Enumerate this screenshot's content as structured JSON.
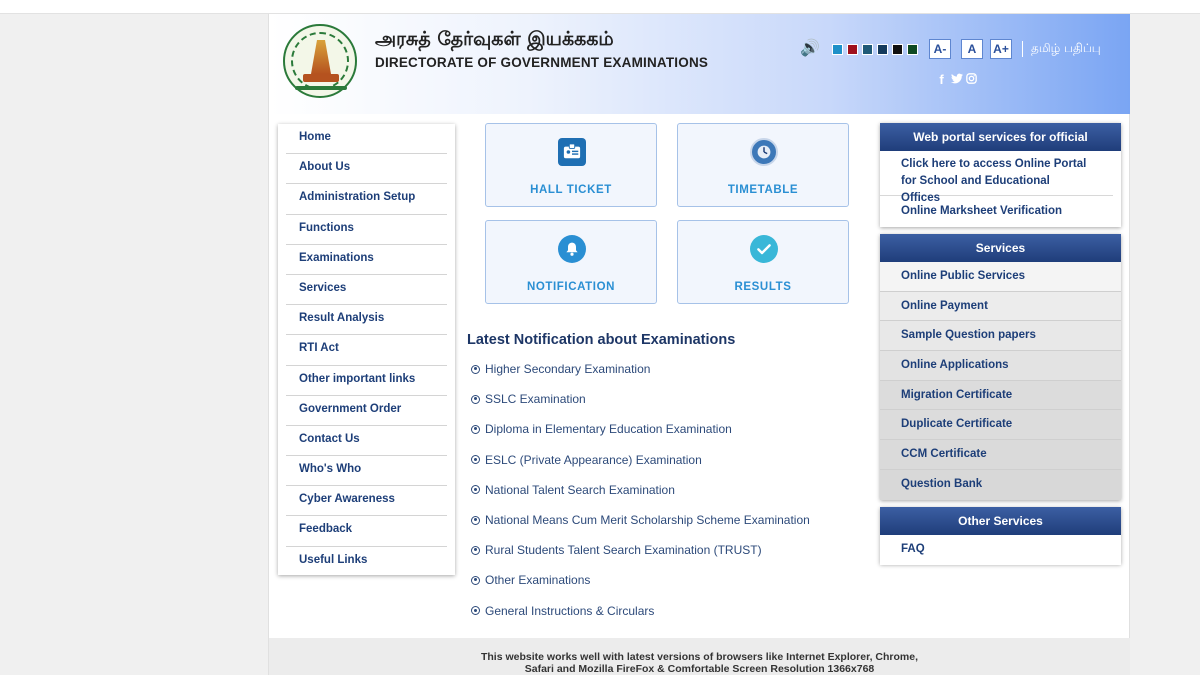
{
  "header": {
    "title_tamil": "அரசுத் தேர்வுகள் இயக்ககம்",
    "title_english": "DIRECTORATE OF GOVERNMENT EXAMINATIONS",
    "font_decrease": "A-",
    "font_normal": "A",
    "font_increase": "A+",
    "tamil_edition": "தமிழ் பதிப்பு",
    "theme_colors": [
      "#1e90c8",
      "#a0101c",
      "#1f5a78",
      "#143a5c",
      "#111111",
      "#0e4a22"
    ],
    "social_icons": [
      "facebook-icon",
      "twitter-icon",
      "instagram-icon"
    ]
  },
  "left_nav": {
    "items": [
      {
        "label": "Home"
      },
      {
        "label": "About Us"
      },
      {
        "label": "Administration Setup"
      },
      {
        "label": "Functions"
      },
      {
        "label": "Examinations"
      },
      {
        "label": "Services"
      },
      {
        "label": "Result Analysis"
      },
      {
        "label": "RTI Act"
      },
      {
        "label": "Other important links"
      },
      {
        "label": "Government Order"
      },
      {
        "label": "Contact Us"
      },
      {
        "label": "Who's Who"
      },
      {
        "label": "Cyber Awareness"
      },
      {
        "label": "Feedback"
      },
      {
        "label": "Useful Links"
      }
    ]
  },
  "tiles": [
    {
      "label": "HALL TICKET",
      "icon": "id-card-icon"
    },
    {
      "label": "TIMETABLE",
      "icon": "clock-icon"
    },
    {
      "label": "NOTIFICATION",
      "icon": "bell-icon"
    },
    {
      "label": "RESULTS",
      "icon": "check-circle-icon"
    }
  ],
  "notifications": {
    "title": "Latest Notification about Examinations",
    "items": [
      {
        "label": "Higher Secondary Examination"
      },
      {
        "label": "SSLC Examination"
      },
      {
        "label": "Diploma in Elementary Education Examination"
      },
      {
        "label": "ESLC (Private Appearance) Examination"
      },
      {
        "label": "National Talent Search Examination"
      },
      {
        "label": "National Means Cum Merit Scholarship Scheme Examination"
      },
      {
        "label": "Rural Students Talent Search Examination (TRUST)"
      },
      {
        "label": "Other Examinations"
      },
      {
        "label": "General Instructions & Circulars"
      }
    ]
  },
  "web_portal": {
    "title": "Web portal services for official",
    "items": [
      {
        "label": "Click here to access Online Portal for School and Educational Offices"
      },
      {
        "label": "Online Marksheet Verification"
      }
    ]
  },
  "services": {
    "title": "Services",
    "items": [
      {
        "label": "Online Public Services",
        "bg": "#f4f4f4"
      },
      {
        "label": "Online Payment",
        "bg": "#ececec"
      },
      {
        "label": "Sample Question papers",
        "bg": "#e8e8e8"
      },
      {
        "label": "Online Applications",
        "bg": "#e3e3e3"
      },
      {
        "label": "Migration Certificate",
        "bg": "#dcdcdc"
      },
      {
        "label": "Duplicate Certificate",
        "bg": "#dcdcdc"
      },
      {
        "label": "CCM Certificate",
        "bg": "#dadada"
      },
      {
        "label": "Question Bank",
        "bg": "#d8d8d8"
      }
    ]
  },
  "other_services": {
    "title": "Other Services",
    "items": [
      {
        "label": "FAQ"
      }
    ]
  },
  "footer": {
    "line1": "This website works well with latest versions of browsers like Internet Explorer, Chrome,",
    "line2": "Safari and Mozilla FireFox & Comfortable Screen Resolution 1366x768"
  }
}
